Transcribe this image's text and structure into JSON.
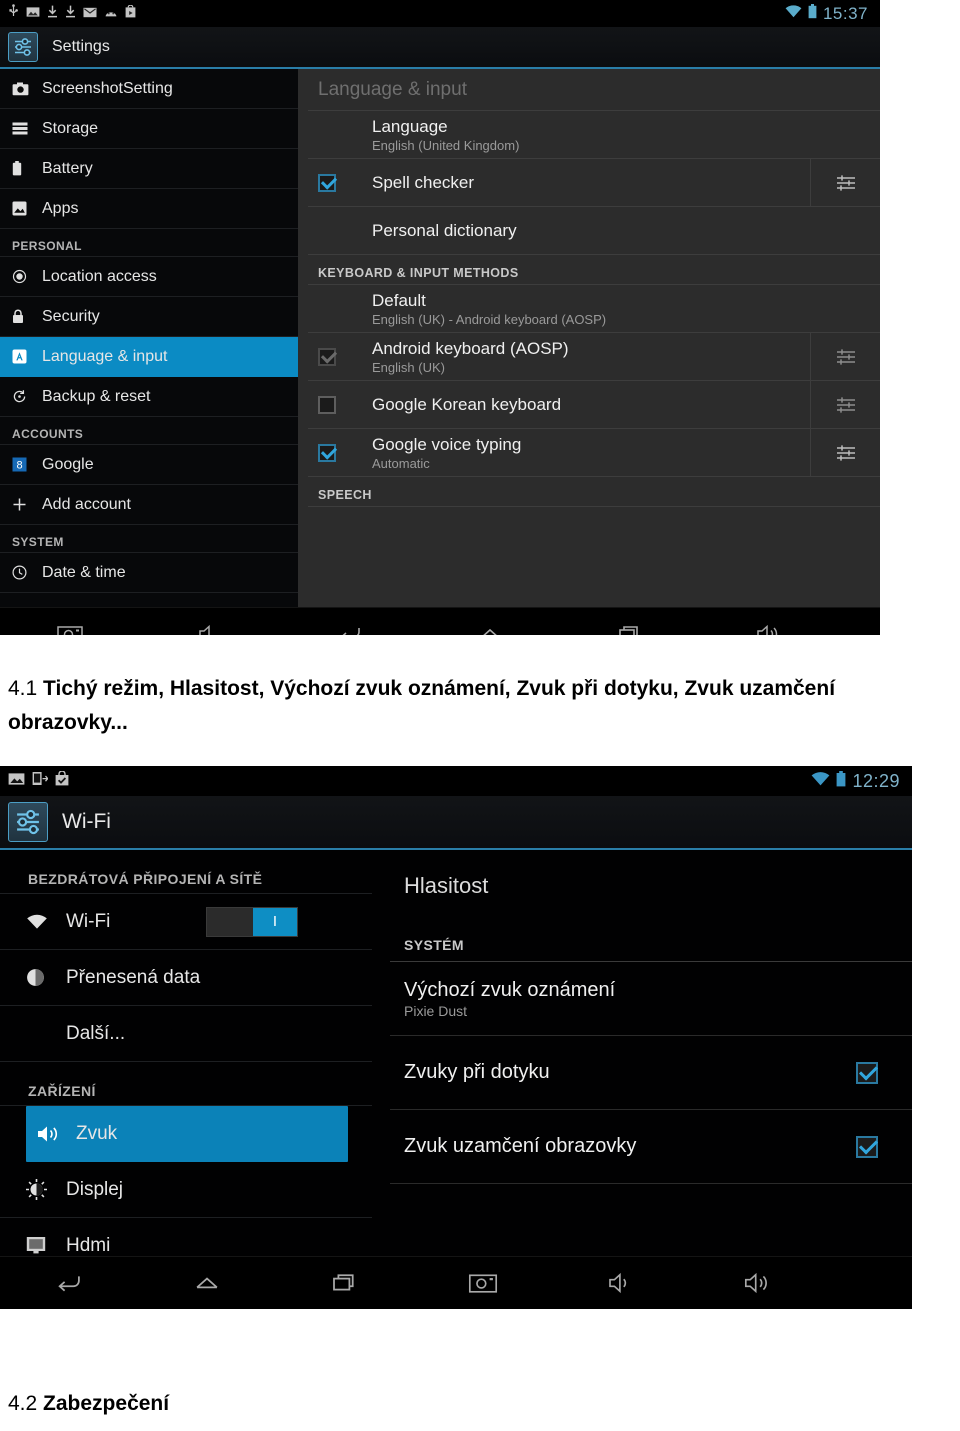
{
  "document": {
    "section_one": {
      "number": "4.1",
      "text": "Tichý režim, Hlasitost, Výchozí zvuk oznámení, Zvuk při dotyku, Zvuk uzamčení obrazovky..."
    },
    "section_two": {
      "number": "4.2",
      "text": "Zabezpečení"
    }
  },
  "screenshot_one": {
    "status_bar": {
      "clock": "15:37",
      "left_icons": [
        "usb-icon",
        "image-icon",
        "download-icon",
        "download-icon",
        "mail-icon",
        "android-icon",
        "play-store-icon"
      ],
      "right_icons": [
        "wifi-icon",
        "battery-icon"
      ]
    },
    "action_bar": {
      "app_icon": "settings-icon",
      "title": "Settings"
    },
    "sidebar": {
      "items": [
        {
          "label": "ScreenshotSetting",
          "icon": "camera-icon",
          "type": "item",
          "selected": false
        },
        {
          "label": "Storage",
          "icon": "storage-icon",
          "type": "item",
          "selected": false
        },
        {
          "label": "Battery",
          "icon": "battery-icon",
          "type": "item",
          "selected": false
        },
        {
          "label": "Apps",
          "icon": "apps-icon",
          "type": "item",
          "selected": false
        },
        {
          "label": "PERSONAL",
          "type": "header"
        },
        {
          "label": "Location access",
          "icon": "location-icon",
          "type": "item",
          "selected": false
        },
        {
          "label": "Security",
          "icon": "lock-icon",
          "type": "item",
          "selected": false
        },
        {
          "label": "Language & input",
          "icon": "language-icon",
          "type": "item",
          "selected": true
        },
        {
          "label": "Backup & reset",
          "icon": "backup-icon",
          "type": "item",
          "selected": false
        },
        {
          "label": "ACCOUNTS",
          "type": "header"
        },
        {
          "label": "Google",
          "icon": "google-icon",
          "type": "item",
          "selected": false
        },
        {
          "label": "Add account",
          "icon": "plus-icon",
          "type": "item",
          "selected": false
        },
        {
          "label": "SYSTEM",
          "type": "header"
        },
        {
          "label": "Date & time",
          "icon": "clock-icon",
          "type": "item",
          "selected": false
        }
      ]
    },
    "content": {
      "title": "Language & input",
      "rows": [
        {
          "type": "item",
          "title": "Language",
          "subtitle": "English (United Kingdom)",
          "checkbox": "none",
          "settings": false
        },
        {
          "type": "item",
          "title": "Spell checker",
          "subtitle": "",
          "checkbox": "checked",
          "settings": true
        },
        {
          "type": "item",
          "title": "Personal dictionary",
          "subtitle": "",
          "checkbox": "none",
          "settings": false
        },
        {
          "type": "header",
          "title": "KEYBOARD & INPUT METHODS"
        },
        {
          "type": "item",
          "title": "Default",
          "subtitle": "English (UK) - Android keyboard (AOSP)",
          "checkbox": "none",
          "settings": false
        },
        {
          "type": "item",
          "title": "Android keyboard (AOSP)",
          "subtitle": "English (UK)",
          "checkbox": "dimmed",
          "settings": true
        },
        {
          "type": "item",
          "title": "Google Korean keyboard",
          "subtitle": "",
          "checkbox": "unchecked",
          "settings": true
        },
        {
          "type": "item",
          "title": "Google voice typing",
          "subtitle": "Automatic",
          "checkbox": "checked",
          "settings": true
        },
        {
          "type": "header",
          "title": "SPEECH"
        }
      ]
    },
    "nav_bar": {
      "buttons": [
        "camera-icon",
        "volume-down-icon",
        "back-icon",
        "home-icon",
        "recents-icon",
        "volume-up-icon"
      ]
    }
  },
  "screenshot_two": {
    "status_bar": {
      "clock": "12:29",
      "left_icons": [
        "image-icon",
        "screenshot-icon",
        "checked-bag-icon"
      ],
      "right_icons": [
        "wifi-icon",
        "battery-icon"
      ]
    },
    "action_bar": {
      "app_icon": "settings-icon",
      "title": "Wi-Fi"
    },
    "sidebar": {
      "items": [
        {
          "label": "BEZDRÁTOVÁ PŘIPOJENÍ A SÍTĚ",
          "type": "header"
        },
        {
          "label": "Wi-Fi",
          "icon": "wifi-icon",
          "type": "item",
          "selected": false,
          "toggle": "on",
          "toggle_label": "I"
        },
        {
          "label": "Přenesená data",
          "icon": "data-usage-icon",
          "type": "item",
          "selected": false
        },
        {
          "label": "Další...",
          "icon": "none",
          "type": "item",
          "selected": false
        },
        {
          "label": "ZAŘÍZENÍ",
          "type": "header"
        },
        {
          "label": "Zvuk",
          "icon": "sound-icon",
          "type": "item",
          "selected": true
        },
        {
          "label": "Displej",
          "icon": "display-icon",
          "type": "item",
          "selected": false
        },
        {
          "label": "Hdmi",
          "icon": "hdmi-icon",
          "type": "item",
          "selected": false
        }
      ]
    },
    "content": {
      "title": "Hlasitost",
      "rows": [
        {
          "type": "header",
          "title": "SYSTÉM"
        },
        {
          "type": "item",
          "title": "Výchozí zvuk oznámení",
          "subtitle": "Pixie Dust",
          "checkbox": "none"
        },
        {
          "type": "item",
          "title": "Zvuky při dotyku",
          "subtitle": "",
          "checkbox": "checked"
        },
        {
          "type": "item",
          "title": "Zvuk uzamčení obrazovky",
          "subtitle": "",
          "checkbox": "checked"
        }
      ]
    },
    "nav_bar": {
      "buttons": [
        "back-icon",
        "home-icon",
        "recents-icon",
        "camera-icon",
        "volume-down-icon",
        "volume-up-icon"
      ]
    }
  },
  "colors": {
    "accent": "#0b8bc4",
    "accent_two": "#0b82b8",
    "panel_dark": "#07080a",
    "panel_gray": "#2c2c2c",
    "text_primary": "#f0f0f0",
    "text_secondary": "#9a9a9a",
    "clock": "#7fb2c9"
  }
}
